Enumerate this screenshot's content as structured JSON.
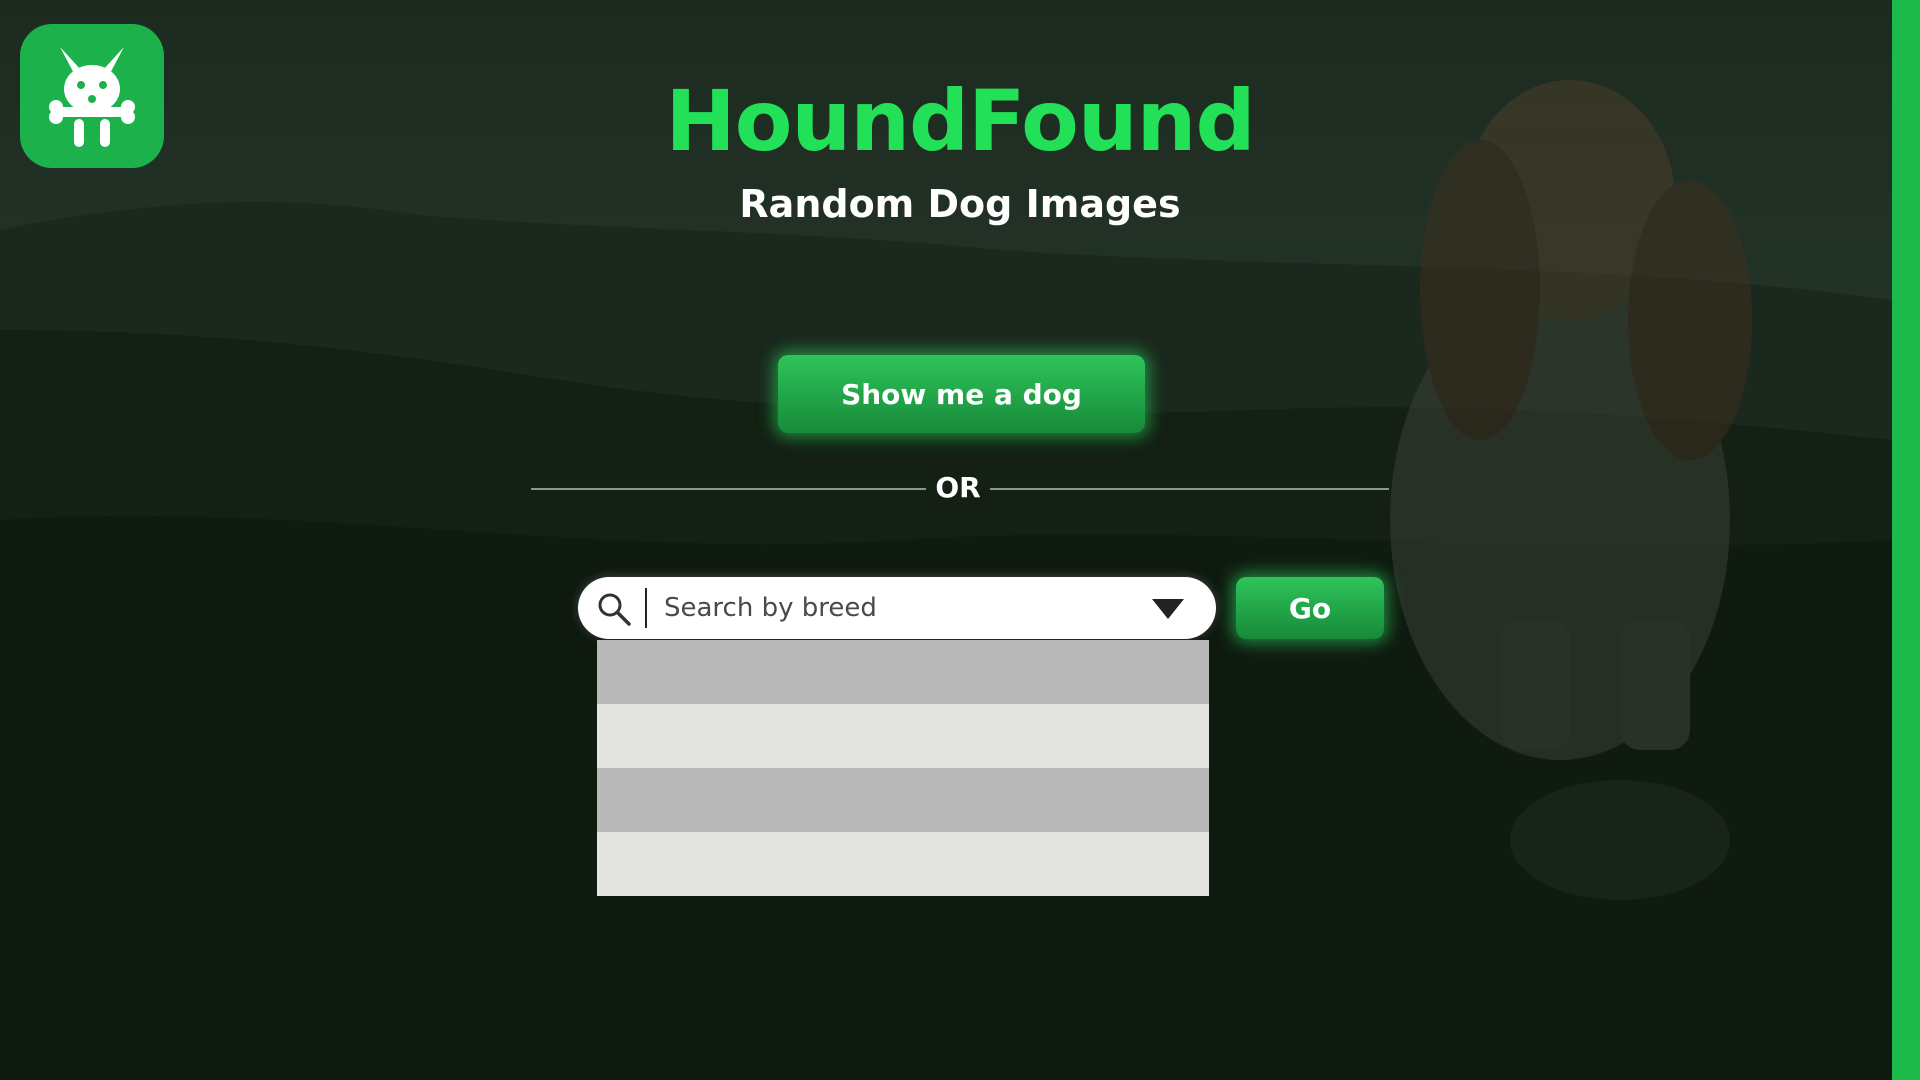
{
  "app": {
    "title": "HoundFound",
    "subtitle": "Random Dog Images",
    "logo_icon": "dog-logo-icon"
  },
  "actions": {
    "random_button_label": "Show me a dog",
    "divider_label": "OR",
    "go_button_label": "Go"
  },
  "search": {
    "placeholder": "Search by breed",
    "value": "",
    "search_icon": "search-icon",
    "dropdown_icon": "triangle-down-icon"
  },
  "dropdown": {
    "options": [
      "",
      "",
      "",
      ""
    ]
  },
  "colors": {
    "accent": "#22e058",
    "button_green": "#1db14c",
    "edge_green": "#1db94a",
    "option_dark": "#b9b9b9",
    "option_light": "#e4e5e3"
  }
}
